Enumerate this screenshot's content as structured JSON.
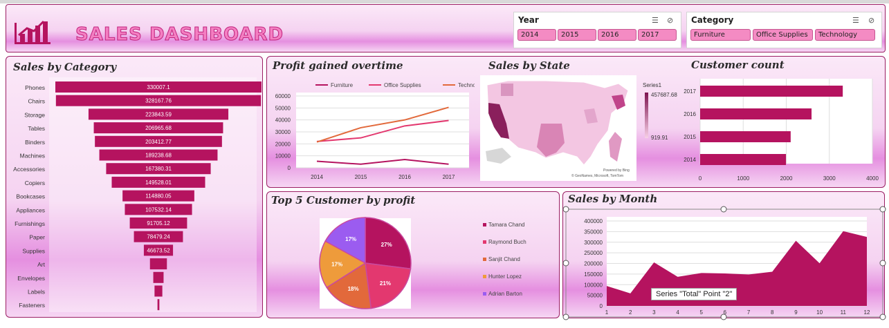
{
  "header": {
    "title": "SALES DASHBOARD",
    "logo_icon": "bar-chart-logo-icon"
  },
  "slicers": {
    "year": {
      "title": "Year",
      "items": [
        "2014",
        "2015",
        "2016",
        "2017"
      ]
    },
    "category": {
      "title": "Category",
      "items": [
        "Furniture",
        "Office Supplies",
        "Technology"
      ]
    }
  },
  "panels": {
    "sales_by_category": "Sales by Category",
    "profit": "Profit gained overtime",
    "state": "Sales by State",
    "customer_count": "Customer count",
    "top5": "Top 5 Customer by profit",
    "month": "Sales by Month"
  },
  "colors": {
    "magenta": "#b5135f",
    "pink": "#e3386f",
    "orange": "#e2693b",
    "amber": "#ee9b3b",
    "purple": "#9b5cf0"
  },
  "map": {
    "legend_title": "Series1",
    "legend_max": "457687.68",
    "legend_min": "919.91",
    "credit_1": "Powered by Bing",
    "credit_2": "© GeoNames, Microsoft, TomTom"
  },
  "tooltip": "Series \"Total\" Point \"2\"",
  "chart_data": [
    {
      "id": "sales_by_category",
      "type": "bar",
      "title": "Sales by Category",
      "categories": [
        "Phones",
        "Chairs",
        "Storage",
        "Tables",
        "Binders",
        "Machines",
        "Accessories",
        "Copiers",
        "Bookcases",
        "Appliances",
        "Furnishings",
        "Paper",
        "Supplies",
        "Art",
        "Envelopes",
        "Labels",
        "Fasteners"
      ],
      "values": [
        330007.1,
        328167.76,
        223843.59,
        206965.68,
        203412.77,
        189238.68,
        167380.31,
        149528.01,
        114880.05,
        107532.14,
        91705.12,
        78479.24,
        46673.52,
        27119,
        16476,
        12486,
        3024
      ],
      "labels": [
        "330007.1",
        "328167.76",
        "223843.59",
        "206965.68",
        "203412.77",
        "189238.68",
        "167380.31",
        "149528.01",
        "114880.05",
        "107532.14",
        "91705.12",
        "78479.24",
        "46673.52",
        "",
        "",
        "",
        ""
      ]
    },
    {
      "id": "profit",
      "type": "line",
      "title": "Profit gained overtime",
      "categories": [
        "2014",
        "2015",
        "2016",
        "2017"
      ],
      "ylim": [
        0,
        60000
      ],
      "yticks": [
        "0",
        "10000",
        "20000",
        "30000",
        "40000",
        "50000",
        "60000"
      ],
      "series": [
        {
          "name": "Furniture",
          "values": [
            5500,
            3000,
            6900,
            3000
          ]
        },
        {
          "name": "Office Supplies",
          "values": [
            22000,
            25000,
            35000,
            39500
          ]
        },
        {
          "name": "Technology",
          "values": [
            21500,
            33500,
            40000,
            50500
          ]
        }
      ]
    },
    {
      "id": "customer_count",
      "type": "bar",
      "title": "Customer count",
      "categories": [
        "2017",
        "2016",
        "2015",
        "2014"
      ],
      "values": [
        3312,
        2587,
        2102,
        1993
      ],
      "xlim": [
        0,
        4000
      ],
      "xticks": [
        "0",
        "1000",
        "2000",
        "3000",
        "4000"
      ]
    },
    {
      "id": "top5",
      "type": "pie",
      "title": "Top 5 Customer by profit",
      "categories": [
        "Tamara Chand",
        "Raymond Buch",
        "Sanjit Chand",
        "Hunter Lopez",
        "Adrian Barton"
      ],
      "values": [
        27,
        21,
        18,
        17,
        17
      ],
      "labels": [
        "27%",
        "21%",
        "18%",
        "17%",
        "17%"
      ]
    },
    {
      "id": "month",
      "type": "area",
      "title": "Sales by Month",
      "categories": [
        "1",
        "2",
        "3",
        "4",
        "5",
        "6",
        "7",
        "8",
        "9",
        "10",
        "11",
        "12"
      ],
      "values": [
        94000,
        59000,
        205000,
        137000,
        155000,
        153000,
        148000,
        161000,
        307000,
        201000,
        352000,
        325000
      ],
      "ylim": [
        0,
        400000
      ],
      "yticks": [
        "0",
        "50000",
        "100000",
        "150000",
        "200000",
        "250000",
        "300000",
        "350000",
        "400000"
      ]
    }
  ]
}
